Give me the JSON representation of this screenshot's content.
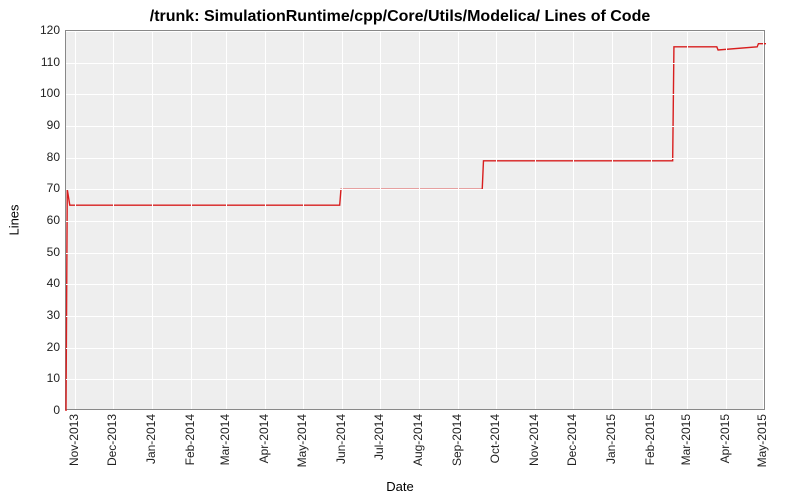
{
  "chart_data": {
    "type": "line",
    "title": "/trunk: SimulationRuntime/cpp/Core/Utils/Modelica/ Lines of Code",
    "xlabel": "Date",
    "ylabel": "Lines",
    "ylim": [
      0,
      120
    ],
    "y_ticks": [
      0,
      10,
      20,
      30,
      40,
      50,
      60,
      70,
      80,
      90,
      100,
      110,
      120
    ],
    "x_ticks": [
      "Nov-2013",
      "Dec-2013",
      "Jan-2014",
      "Feb-2014",
      "Mar-2014",
      "Apr-2014",
      "May-2014",
      "Jun-2014",
      "Jul-2014",
      "Aug-2014",
      "Sep-2014",
      "Oct-2014",
      "Nov-2014",
      "Dec-2014",
      "Jan-2015",
      "Feb-2015",
      "Mar-2015",
      "Apr-2015",
      "May-2015"
    ],
    "x_range_days": 555,
    "series": [
      {
        "name": "Lines of Code",
        "color": "#d81e1e",
        "points": [
          {
            "x": "2013-10-25",
            "y": 0
          },
          {
            "x": "2013-10-26",
            "y": 70
          },
          {
            "x": "2013-10-28",
            "y": 65
          },
          {
            "x": "2014-05-30",
            "y": 65
          },
          {
            "x": "2014-05-31",
            "y": 70
          },
          {
            "x": "2014-09-20",
            "y": 70
          },
          {
            "x": "2014-09-21",
            "y": 79
          },
          {
            "x": "2015-02-18",
            "y": 79
          },
          {
            "x": "2015-02-19",
            "y": 115
          },
          {
            "x": "2015-03-25",
            "y": 115
          },
          {
            "x": "2015-03-26",
            "y": 114
          },
          {
            "x": "2015-04-26",
            "y": 115
          },
          {
            "x": "2015-04-27",
            "y": 116
          },
          {
            "x": "2015-05-03",
            "y": 116
          }
        ]
      }
    ]
  }
}
